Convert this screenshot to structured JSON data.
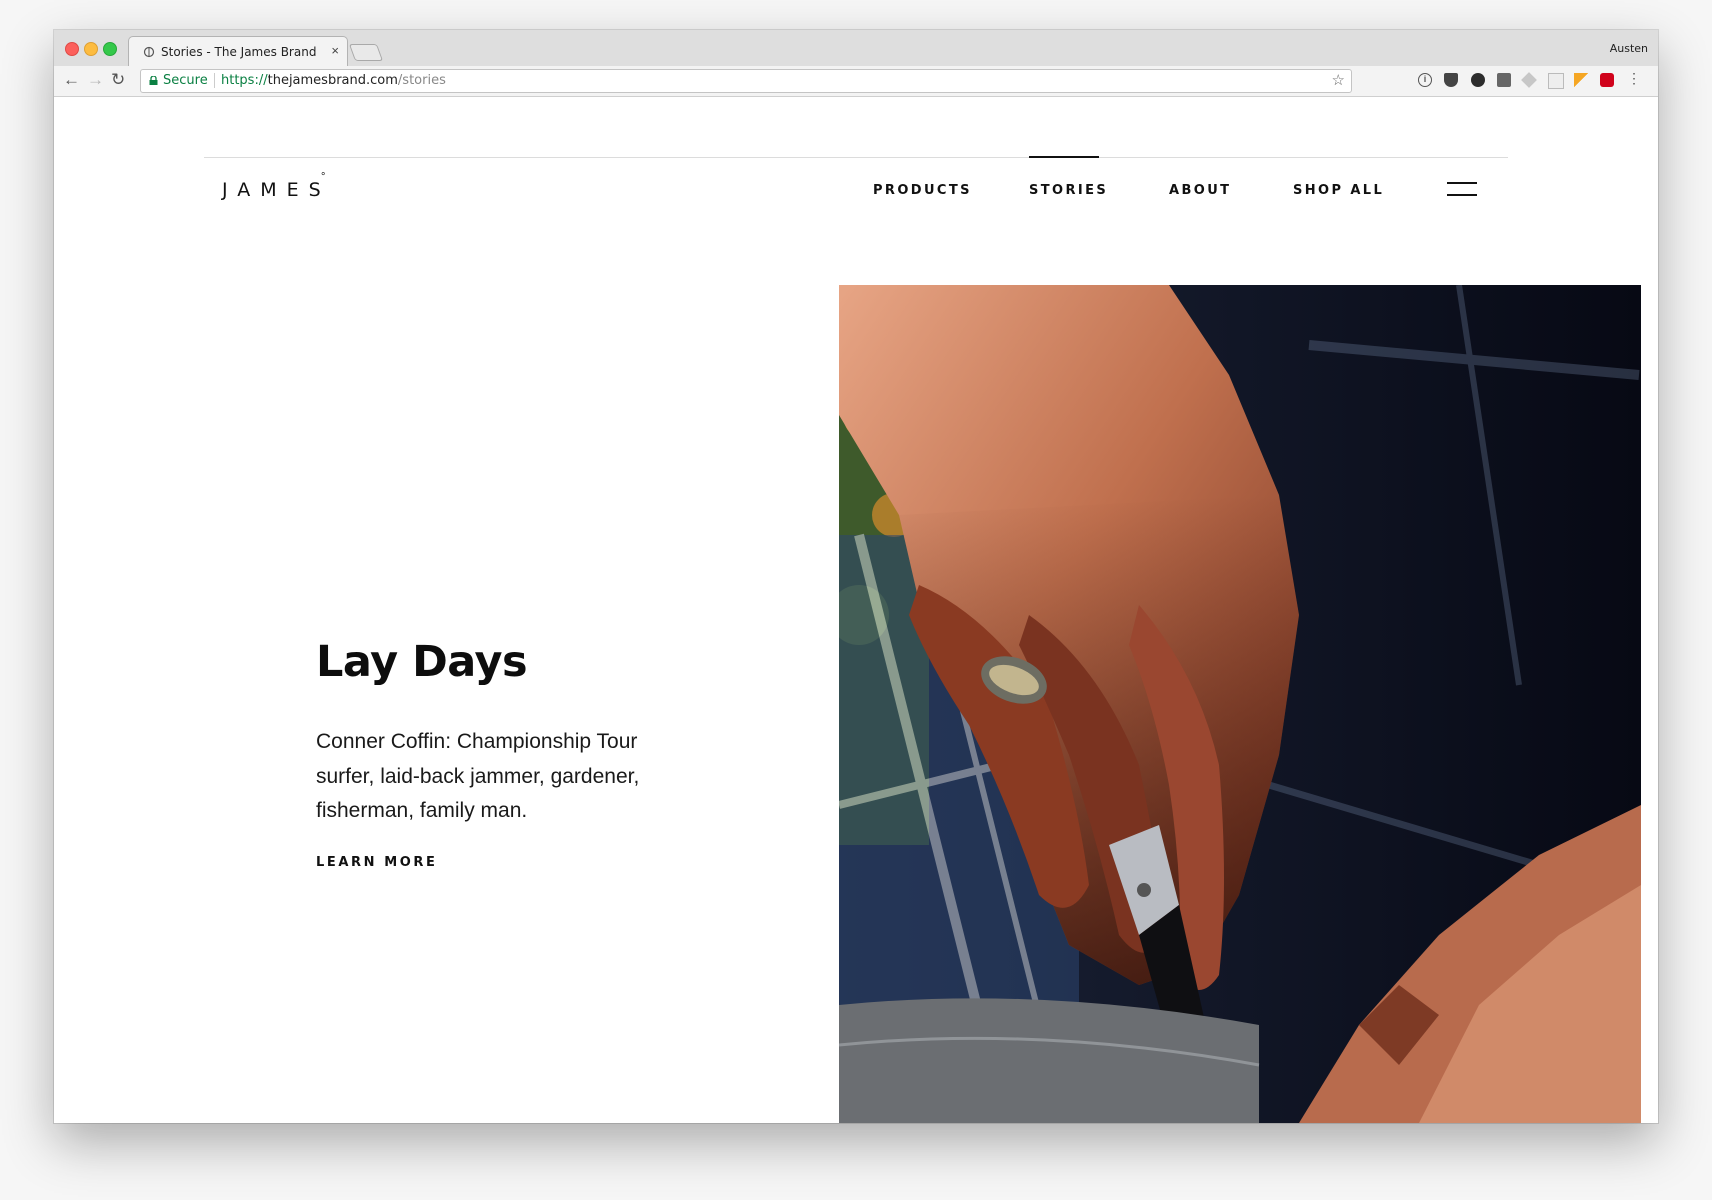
{
  "browser": {
    "tab_title": "Stories - The James Brand",
    "tab_close": "×",
    "profile_name": "Austen",
    "secure_label": "Secure",
    "url_scheme": "https://",
    "url_host": "thejamesbrand.com",
    "url_path": "/stories",
    "star": "☆",
    "menu": "⋮",
    "back": "←",
    "forward": "→",
    "reload": "↻",
    "info_glyph": "i"
  },
  "site": {
    "logo": "JAMES",
    "logo_mark": "°",
    "nav": {
      "products": "PRODUCTS",
      "stories": "STORIES",
      "about": "ABOUT",
      "shop_all": "SHOP ALL"
    },
    "active_nav": "stories"
  },
  "story": {
    "title": "Lay Days",
    "description": "Conner Coffin: Championship Tour surfer, laid-back jammer, gardener, fisherman, family man.",
    "cta": "LEARN MORE"
  },
  "colors": {
    "secure_green": "#0b8043",
    "text": "#111111",
    "hero_background": "#0a0c1a",
    "skin": "#b4674a"
  }
}
